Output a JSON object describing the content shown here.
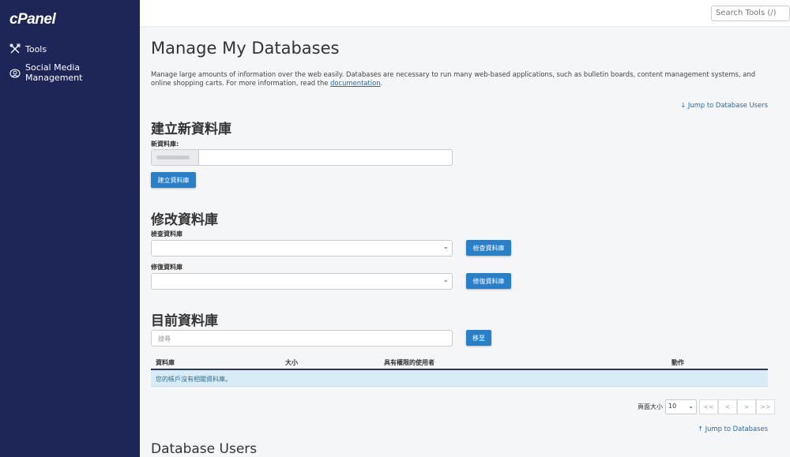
{
  "sidebar": {
    "logo": "cPanel",
    "items": [
      {
        "label": "Tools",
        "icon": "tools-icon"
      },
      {
        "label": "Social Media Management",
        "icon": "social-icon"
      }
    ]
  },
  "topbar": {
    "search_placeholder": "Search Tools (/)"
  },
  "page": {
    "title": "Manage My Databases",
    "description": "Manage large amounts of information over the web easily. Databases are necessary to run many web-based applications, such as bulletin boards, content management systems, and online shopping carts. For more information, read the ",
    "doc_link": "documentation",
    "desc_end": ".",
    "jump_users": "↓ Jump to Database Users",
    "jump_db": "↑ Jump to Databases"
  },
  "create": {
    "heading": "建立新資料庫",
    "label": "新資料庫:",
    "button": "建立資料庫"
  },
  "modify": {
    "heading": "修改資料庫",
    "check_label": "檢查資料庫",
    "check_button": "檢查資料庫",
    "repair_label": "修復資料庫",
    "repair_button": "修復資料庫"
  },
  "current": {
    "heading": "目前資料庫",
    "search_placeholder": "搜尋",
    "go_button": "移至",
    "columns": [
      "資料庫",
      "大小",
      "具有權限的使用者",
      "動作"
    ],
    "empty_message": "您的帳戶沒有相關資料庫。"
  },
  "pagination": {
    "page_size_label": "頁面大小",
    "page_size": "10",
    "buttons": [
      "<<",
      "<",
      ">",
      ">>"
    ]
  },
  "users": {
    "heading": "Database Users"
  },
  "colors": {
    "sidebar_bg": "#1e2557",
    "primary_button": "#2a7fc9",
    "link": "#1c6cb4",
    "info_row": "#d7ecf6"
  }
}
